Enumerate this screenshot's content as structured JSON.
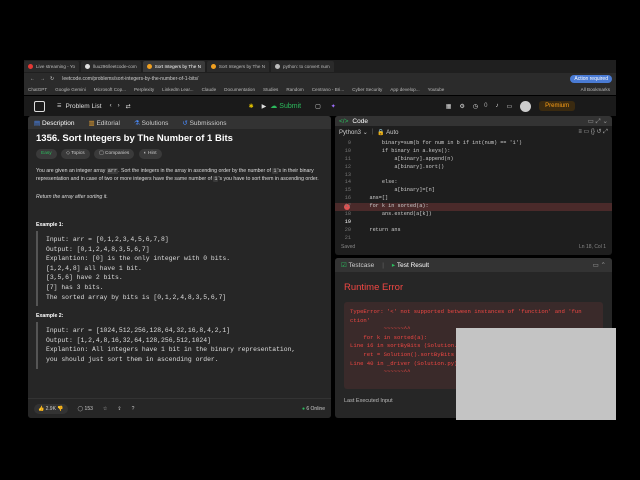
{
  "browser": {
    "tabs": [
      {
        "label": "Live streaming - Yo",
        "color": "#e53935",
        "active": false
      },
      {
        "label": "lluu296/leetcode-com",
        "color": "#e0e0e0",
        "active": false
      },
      {
        "label": "Sort Integers by The N",
        "color": "#f0a020",
        "active": true
      },
      {
        "label": "Sort Integers by The N",
        "color": "#f0a020",
        "active": false
      },
      {
        "label": "python: to convert num",
        "color": "#bdbdbd",
        "active": false
      }
    ],
    "url": "leetcode.com/problems/sort-integers-by-the-number-of-1-bits/",
    "action_label": "Action required",
    "bookmarks": [
      "ChatGPT",
      "Google Gemini",
      "Microsoft Cop...",
      "Perplexity",
      "LinkedIn Lear...",
      "Claude",
      "Documentation",
      "Studies",
      "Random",
      "Centrano - Bri...",
      "Cyber Security",
      "App develop...",
      "Youtube",
      "All Bookmarks"
    ]
  },
  "header": {
    "problem_list": "Problem List",
    "submit": "Submit",
    "premium": "Premium"
  },
  "left_tabs": [
    "Description",
    "Editorial",
    "Solutions",
    "Submissions"
  ],
  "problem": {
    "title": "1356. Sort Integers by The Number of 1 Bits",
    "difficulty": "Easy",
    "tags": [
      "Topics",
      "Companies",
      "Hint"
    ],
    "statement_1": "You are given an integer array",
    "statement_code": "arr",
    "statement_2": ". Sort the integers in the array in ascending order by the number of",
    "statement_code2": "1",
    "statement_3": "'s in their binary representation and in case of two or more integers have the same number of",
    "statement_code3": "1",
    "statement_4": "'s you have to sort them in ascending order.",
    "note": "Return the array after sorting it.",
    "example1_label": "Example 1:",
    "example1": "Input: arr = [0,1,2,3,4,5,6,7,8]\nOutput: [0,1,2,4,8,3,5,6,7]\nExplantion: [0] is the only integer with 0 bits.\n[1,2,4,8] all have 1 bit.\n[3,5,6] have 2 bits.\n[7] has 3 bits.\nThe sorted array by bits is [0,1,2,4,8,3,5,6,7]",
    "example2_label": "Example 2:",
    "example2": "Input: arr = [1024,512,256,128,64,32,16,8,4,2,1]\nOutput: [1,2,4,8,16,32,64,128,256,512,1024]\nExplantion: All integers have 1 bit in the binary representation,\nyou should just sort them in ascending order."
  },
  "left_footer": {
    "likes": "2.9K",
    "comments": "153",
    "online": "6 Online"
  },
  "code": {
    "title": "Code",
    "language": "Python3",
    "mode": "Auto",
    "status": "Saved",
    "cursor": "Ln 18, Col 1",
    "lines": [
      {
        "n": "9",
        "t": "        binary=sum(b for num in b if int(num) == '1')"
      },
      {
        "n": "10",
        "t": "        if binary in a.keys():"
      },
      {
        "n": "11",
        "t": "            a[binary].append(n)"
      },
      {
        "n": "12",
        "t": "            a[binary].sort()"
      },
      {
        "n": "13",
        "t": ""
      },
      {
        "n": "14",
        "t": "        else:"
      },
      {
        "n": "15",
        "t": "            a[binary]=[n]"
      },
      {
        "n": "16",
        "t": "    ans=[]"
      },
      {
        "n": "17",
        "t": "    for k in sorted(a):"
      },
      {
        "n": "18",
        "t": "        ans.extend(a[k])"
      },
      {
        "n": "19",
        "t": ""
      },
      {
        "n": "20",
        "t": "    return ans"
      },
      {
        "n": "21",
        "t": ""
      }
    ]
  },
  "result": {
    "tabs": [
      "Testcase",
      "Test Result"
    ],
    "title": "Runtime Error",
    "error": "TypeError: '<' not supported between instances of 'function' and 'fun\nction'\n          ~~~~~~^^\n    for k in sorted(a):\nLine 16 in sortByBits (Solution.py)\n    ret = Solution().sortByBits\nLine 40 in _driver (Solution.py)\n          ~~~~~~^^",
    "last_input": "Last Executed Input"
  },
  "colors": {
    "accent": "#2cbb5d",
    "error": "#ef4743",
    "premium": "#ffa116"
  }
}
